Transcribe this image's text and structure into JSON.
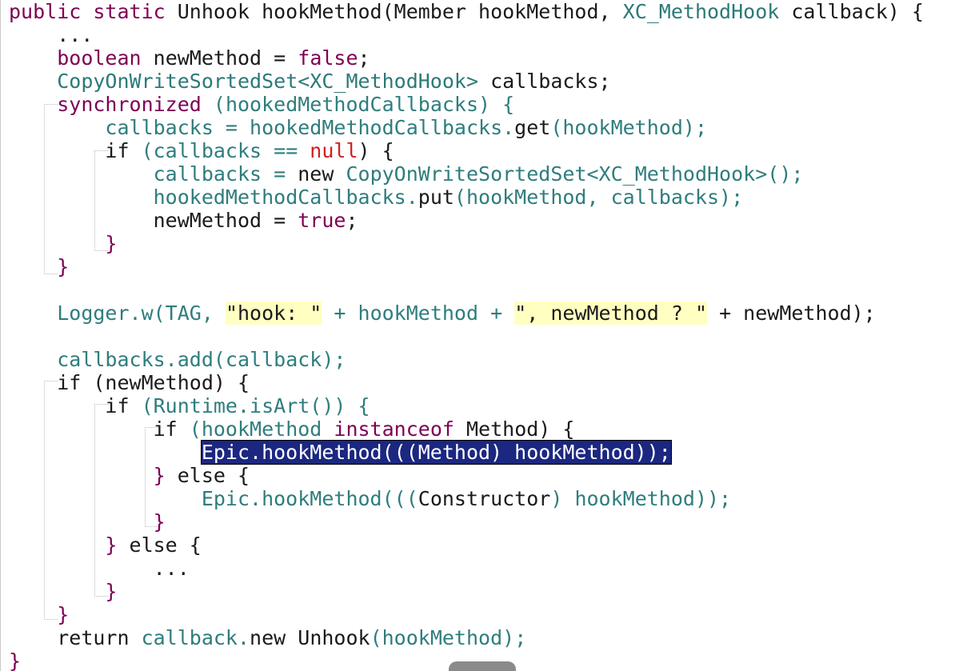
{
  "editor": {
    "lines": [
      [
        {
          "t": "public ",
          "c": "tok-kw"
        },
        {
          "t": "static ",
          "c": "tok-kw"
        },
        {
          "t": "Unhook ",
          "c": "tok-plain"
        },
        {
          "t": "hookMethod",
          "c": "tok-plain"
        },
        {
          "t": "(",
          "c": "tok-plain"
        },
        {
          "t": "Member ",
          "c": "tok-plain"
        },
        {
          "t": "hookMethod, ",
          "c": "tok-plain"
        },
        {
          "t": "XC_MethodHook ",
          "c": "tok-type"
        },
        {
          "t": "callback",
          "c": "tok-plain"
        },
        {
          "t": ") {",
          "c": "tok-plain"
        }
      ],
      [
        {
          "t": "    ...",
          "c": "tok-plain"
        }
      ],
      [
        {
          "t": "    ",
          "c": "tok-plain"
        },
        {
          "t": "boolean ",
          "c": "tok-purple"
        },
        {
          "t": "newMethod = ",
          "c": "tok-plain"
        },
        {
          "t": "false",
          "c": "tok-purple"
        },
        {
          "t": ";",
          "c": "tok-plain"
        }
      ],
      [
        {
          "t": "    ",
          "c": "tok-plain"
        },
        {
          "t": "CopyOnWriteSortedSet<XC_MethodHook> ",
          "c": "tok-type"
        },
        {
          "t": "callbacks;",
          "c": "tok-plain"
        }
      ],
      [
        {
          "t": "    ",
          "c": "tok-plain"
        },
        {
          "t": "synchronized ",
          "c": "tok-purple"
        },
        {
          "t": "(hookedMethodCallbacks) {",
          "c": "tok-teal"
        }
      ],
      [
        {
          "t": "        ",
          "c": "tok-plain"
        },
        {
          "t": "callbacks = hookedMethodCallbacks.",
          "c": "tok-teal"
        },
        {
          "t": "get",
          "c": "tok-plain"
        },
        {
          "t": "(hookMethod);",
          "c": "tok-teal"
        }
      ],
      [
        {
          "t": "        ",
          "c": "tok-plain"
        },
        {
          "t": "if ",
          "c": "tok-plain"
        },
        {
          "t": "(callbacks == ",
          "c": "tok-teal"
        },
        {
          "t": "null",
          "c": "tok-null"
        },
        {
          "t": ") {",
          "c": "tok-plain"
        }
      ],
      [
        {
          "t": "            ",
          "c": "tok-plain"
        },
        {
          "t": "callbacks = ",
          "c": "tok-teal"
        },
        {
          "t": "new ",
          "c": "tok-plain"
        },
        {
          "t": "CopyOnWriteSortedSet<XC_MethodHook>();",
          "c": "tok-teal"
        }
      ],
      [
        {
          "t": "            ",
          "c": "tok-plain"
        },
        {
          "t": "hookedMethodCallbacks.",
          "c": "tok-teal"
        },
        {
          "t": "put",
          "c": "tok-plain"
        },
        {
          "t": "(hookMethod, callbacks);",
          "c": "tok-teal"
        }
      ],
      [
        {
          "t": "            ",
          "c": "tok-plain"
        },
        {
          "t": "newMethod = ",
          "c": "tok-plain"
        },
        {
          "t": "true",
          "c": "tok-purple"
        },
        {
          "t": ";",
          "c": "tok-plain"
        }
      ],
      [
        {
          "t": "        }",
          "c": "tok-purple"
        }
      ],
      [
        {
          "t": "    }",
          "c": "tok-purple"
        }
      ],
      [
        {
          "t": "",
          "c": "tok-plain"
        }
      ],
      [
        {
          "t": "    ",
          "c": "tok-plain"
        },
        {
          "t": "Logger.w(TAG, ",
          "c": "tok-teal"
        },
        {
          "t": "\"hook: \"",
          "c": "tok-string"
        },
        {
          "t": " + hookMethod + ",
          "c": "tok-teal"
        },
        {
          "t": "\", newMethod ? \"",
          "c": "tok-string"
        },
        {
          "t": " + newMethod);",
          "c": "tok-plain"
        }
      ],
      [
        {
          "t": "",
          "c": "tok-plain"
        }
      ],
      [
        {
          "t": "    ",
          "c": "tok-plain"
        },
        {
          "t": "callbacks.add(callback);",
          "c": "tok-teal"
        }
      ],
      [
        {
          "t": "    ",
          "c": "tok-plain"
        },
        {
          "t": "if ",
          "c": "tok-plain"
        },
        {
          "t": "(newMethod) {",
          "c": "tok-plain"
        }
      ],
      [
        {
          "t": "        ",
          "c": "tok-plain"
        },
        {
          "t": "if ",
          "c": "tok-plain"
        },
        {
          "t": "(Runtime.isArt()) {",
          "c": "tok-teal"
        }
      ],
      [
        {
          "t": "            ",
          "c": "tok-plain"
        },
        {
          "t": "if ",
          "c": "tok-plain"
        },
        {
          "t": "(hookMethod ",
          "c": "tok-teal"
        },
        {
          "t": "instanceof ",
          "c": "tok-purple"
        },
        {
          "t": "Method",
          "c": "tok-plain"
        },
        {
          "t": ") {",
          "c": "tok-plain"
        }
      ],
      [
        {
          "t": "                ",
          "c": "tok-plain"
        },
        {
          "t": "Epic.hookMethod(((Method) hookMethod));",
          "c": "tok-selected"
        }
      ],
      [
        {
          "t": "            ",
          "c": "tok-plain"
        },
        {
          "t": "} ",
          "c": "tok-purple"
        },
        {
          "t": "else ",
          "c": "tok-plain"
        },
        {
          "t": "{",
          "c": "tok-plain"
        }
      ],
      [
        {
          "t": "                ",
          "c": "tok-plain"
        },
        {
          "t": "Epic.hookMethod(((",
          "c": "tok-teal"
        },
        {
          "t": "Constructor",
          "c": "tok-plain"
        },
        {
          "t": ") hookMethod));",
          "c": "tok-teal"
        }
      ],
      [
        {
          "t": "            }",
          "c": "tok-purple"
        }
      ],
      [
        {
          "t": "        ",
          "c": "tok-plain"
        },
        {
          "t": "} ",
          "c": "tok-purple"
        },
        {
          "t": "else ",
          "c": "tok-plain"
        },
        {
          "t": "{",
          "c": "tok-plain"
        }
      ],
      [
        {
          "t": "            ...",
          "c": "tok-plain"
        }
      ],
      [
        {
          "t": "        }",
          "c": "tok-purple"
        }
      ],
      [
        {
          "t": "    }",
          "c": "tok-purple"
        }
      ],
      [
        {
          "t": "    ",
          "c": "tok-plain"
        },
        {
          "t": "return ",
          "c": "tok-plain"
        },
        {
          "t": "callback.",
          "c": "tok-teal"
        },
        {
          "t": "new ",
          "c": "tok-plain"
        },
        {
          "t": "Unhook",
          "c": "tok-plain"
        },
        {
          "t": "(hookMethod);",
          "c": "tok-teal"
        }
      ],
      [
        {
          "t": "}",
          "c": "tok-purple"
        }
      ]
    ]
  }
}
